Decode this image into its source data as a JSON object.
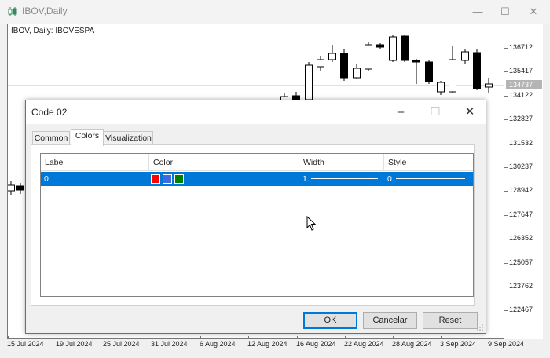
{
  "window": {
    "title": "IBOV,Daily"
  },
  "chart": {
    "label": "IBOV, Daily:  IBOVESPA",
    "price_labels": [
      "136712",
      "135417",
      "134122",
      "132827",
      "131532",
      "130237",
      "128942",
      "127647",
      "126352",
      "125057",
      "123762",
      "122467"
    ],
    "current_price": "134737",
    "time_labels": [
      "15 Jul 2024",
      "19 Jul 2024",
      "25 Jul 2024",
      "31 Jul 2024",
      "6 Aug 2024",
      "12 Aug 2024",
      "16 Aug 2024",
      "22 Aug 2024",
      "28 Aug 2024",
      "3 Sep 2024",
      "9 Sep 2024"
    ],
    "colors": {
      "candle_up": "#ffffff",
      "candle_down": "#000000",
      "outline": "#000000",
      "price_line": "#c0c0c0"
    }
  },
  "dialog": {
    "title": "Code 02",
    "tabs": [
      {
        "label": "Common"
      },
      {
        "label": "Colors"
      },
      {
        "label": "Visualization"
      }
    ],
    "active_tab": "Colors",
    "grid": {
      "headers": [
        "Label",
        "Color",
        "Width",
        "Style"
      ],
      "rows": [
        {
          "label": "0",
          "colors": [
            "#ff0000",
            "#4169e1",
            "#008000"
          ],
          "width": "1.",
          "style": "0."
        }
      ]
    },
    "buttons": {
      "ok": "OK",
      "cancel": "Cancelar",
      "reset": "Reset"
    }
  }
}
